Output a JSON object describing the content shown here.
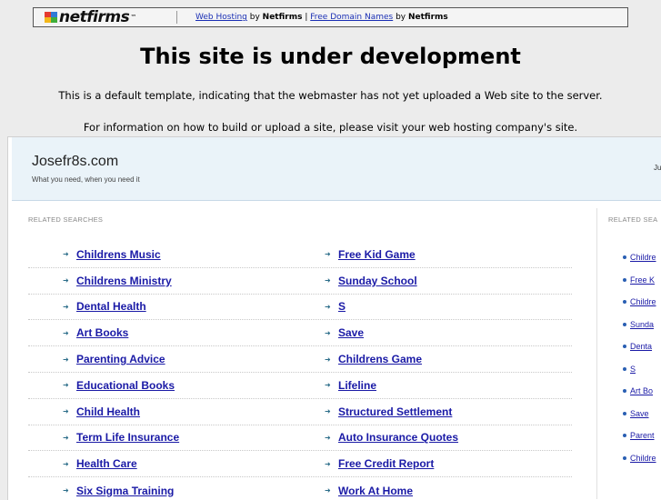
{
  "banner": {
    "logo_text": "netfirms",
    "link1": "Web Hosting",
    "by1": " by ",
    "brand1": "Netfirms",
    "sep": " | ",
    "link2": "Free Domain Names",
    "by2": " by ",
    "brand2": "Netfirms"
  },
  "notice": {
    "title": "This site is under development",
    "line1": "This is a default template, indicating that the webmaster has not yet uploaded a Web site to the server.",
    "line2": "For information on how to build or upload a site, please visit your web hosting company's site."
  },
  "parked": {
    "site_name": "Josefr8s.com",
    "tagline": "What you need, when you need it",
    "header_right": "Ju",
    "related_label": "RELATED SEARCHES",
    "right_label": "RELATED SEA",
    "rows": [
      {
        "left": "Childrens Music",
        "right": "Free Kid Game"
      },
      {
        "left": "Childrens Ministry",
        "right": "Sunday School"
      },
      {
        "left": "Dental Health",
        "right": "S"
      },
      {
        "left": "Art Books",
        "right": "Save"
      },
      {
        "left": "Parenting Advice",
        "right": "Childrens Game"
      },
      {
        "left": "Educational Books",
        "right": "Lifeline"
      },
      {
        "left": "Child Health",
        "right": "Structured Settlement"
      },
      {
        "left": "Term Life Insurance",
        "right": "Auto Insurance Quotes"
      },
      {
        "left": "Health Care",
        "right": "Free Credit Report"
      },
      {
        "left": "Six Sigma Training",
        "right": "Work At Home"
      }
    ],
    "right_list": [
      "Childre",
      "Free K",
      "Childre",
      "Sunda",
      "Denta",
      "S",
      "Art Bo",
      "Save",
      "Parent",
      "Childre"
    ]
  }
}
